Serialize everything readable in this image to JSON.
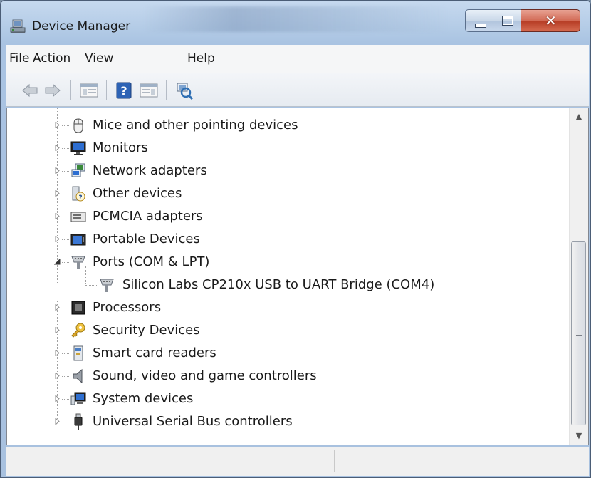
{
  "window": {
    "title": "Device Manager"
  },
  "menu": [
    {
      "key": "F",
      "rest": "ile"
    },
    {
      "key": "A",
      "rest": "ction"
    },
    {
      "key": "V",
      "rest": "iew"
    },
    {
      "key": "H",
      "rest": "elp"
    }
  ],
  "toolbar": {
    "buttons": [
      "back-arrow-icon",
      "forward-arrow-icon",
      "show-hide-console-tree-icon",
      "help-icon",
      "properties-pane-icon",
      "scan-hardware-changes-icon"
    ]
  },
  "tree": {
    "items": [
      {
        "label": "Mice and other pointing devices",
        "icon": "mouse-icon",
        "expanded": false
      },
      {
        "label": "Monitors",
        "icon": "monitor-icon",
        "expanded": false
      },
      {
        "label": "Network adapters",
        "icon": "network-adapter-icon",
        "expanded": false
      },
      {
        "label": "Other devices",
        "icon": "unknown-device-icon",
        "expanded": false
      },
      {
        "label": "PCMCIA adapters",
        "icon": "pcmcia-icon",
        "expanded": false
      },
      {
        "label": "Portable Devices",
        "icon": "portable-device-icon",
        "expanded": false
      },
      {
        "label": "Ports (COM & LPT)",
        "icon": "port-icon",
        "expanded": true
      },
      {
        "label": "Silicon Labs CP210x USB to UART Bridge (COM4)",
        "icon": "port-icon",
        "child": true
      },
      {
        "label": "Processors",
        "icon": "processor-icon",
        "expanded": false
      },
      {
        "label": "Security Devices",
        "icon": "security-key-icon",
        "expanded": false
      },
      {
        "label": "Smart card readers",
        "icon": "smart-card-reader-icon",
        "expanded": false
      },
      {
        "label": "Sound, video and game controllers",
        "icon": "speaker-icon",
        "expanded": false
      },
      {
        "label": "System devices",
        "icon": "system-device-icon",
        "expanded": false
      },
      {
        "label": "Universal Serial Bus controllers",
        "icon": "usb-icon",
        "expanded": false
      }
    ]
  },
  "scroll": {
    "position": 0.62
  },
  "colors": {
    "selection": "#3399ff",
    "titlebar": "#b3cbe6",
    "close": "#c74a31"
  }
}
